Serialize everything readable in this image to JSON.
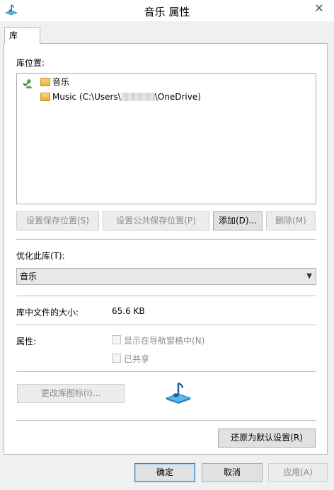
{
  "window": {
    "title": "音乐 属性",
    "close_glyph": "✕"
  },
  "tabs": [
    {
      "label": "库"
    }
  ],
  "library": {
    "locations_label": "库位置:",
    "locations": [
      {
        "name": "音乐",
        "is_default_save": true
      },
      {
        "name_prefix": "Music (C:\\Users\\",
        "name_suffix": "\\OneDrive)",
        "is_default_save": false
      }
    ],
    "buttons": {
      "set_save_location": "设置保存位置(S)",
      "set_public_save_location": "设置公共保存位置(P)",
      "add": "添加(D)...",
      "remove": "删除(M)"
    },
    "optimize_label": "优化此库(T):",
    "optimize_value": "音乐",
    "size_label": "库中文件的大小:",
    "size_value": "65.6 KB",
    "attributes_label": "属性:",
    "show_in_nav_label": "显示在导航窗格中(N)",
    "shared_label": "已共享",
    "change_icon_button": "更改库图标(I)...",
    "restore_defaults_button": "还原为默认设置(R)"
  },
  "dialog_buttons": {
    "ok": "确定",
    "cancel": "取消",
    "apply": "应用(A)"
  },
  "icons": {
    "title_icon": "music-library-icon",
    "library_icon": "music-library-icon",
    "default_save_marker": "checkmark-people-icon",
    "folder": "folder-icon"
  }
}
